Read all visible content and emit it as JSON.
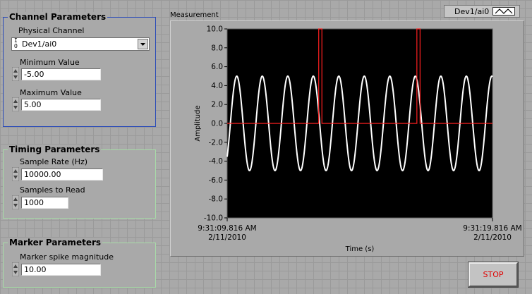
{
  "channel": {
    "title": "Channel Parameters",
    "physical_channel_label": "Physical Channel",
    "physical_channel_value": "Dev1/ai0",
    "io_glyph": "I/O",
    "min_label": "Minimum Value",
    "min_value": "-5.00",
    "max_label": "Maximum Value",
    "max_value": "5.00"
  },
  "timing": {
    "title": "Timing Parameters",
    "rate_label": "Sample Rate (Hz)",
    "rate_value": "10000.00",
    "samples_label": "Samples to Read",
    "samples_value": "1000"
  },
  "marker": {
    "title": "Marker Parameters",
    "magnitude_label": "Marker spike magnitude",
    "magnitude_value": "10.00"
  },
  "graph": {
    "caption": "Measurement",
    "legend_name": "Dev1/ai0",
    "legend_icon": "plot-line-icon"
  },
  "stop_label": "STOP",
  "colors": {
    "panel_bg": "#a9a9a9",
    "channel_border": "#2a4bb8",
    "timing_border": "#a8dca8",
    "plot_bg": "#000000",
    "signal": "#ffffff",
    "marker": "#ff2020",
    "stop_text": "#e00000"
  },
  "chart_data": {
    "type": "line",
    "title": "",
    "xlabel": "Time (s)",
    "ylabel": "Amplitude",
    "ylim": [
      -10,
      10
    ],
    "yticks": [
      "10.0",
      "8.0",
      "6.0",
      "4.0",
      "2.0",
      "0.0",
      "-2.0",
      "-4.0",
      "-6.0",
      "-8.0",
      "-10.0"
    ],
    "xlim_seconds": [
      0,
      10
    ],
    "xticks": [
      {
        "time": "9:31:09.816 AM",
        "date": "2/11/2010"
      },
      {
        "time": "9:31:19.816 AM",
        "date": "2/11/2010"
      }
    ],
    "grid": false,
    "series": [
      {
        "name": "Dev1/ai0",
        "kind": "sine",
        "amplitude": 5.0,
        "cycles": 10.4,
        "phase_deg": -45,
        "color": "#ffffff"
      },
      {
        "kind": "marker",
        "baseline": 0.0,
        "spike_magnitude": 10.0,
        "spike_times_s": [
          3.45,
          7.15
        ],
        "spike_width_s": 0.12,
        "color": "#ff2020"
      }
    ]
  }
}
